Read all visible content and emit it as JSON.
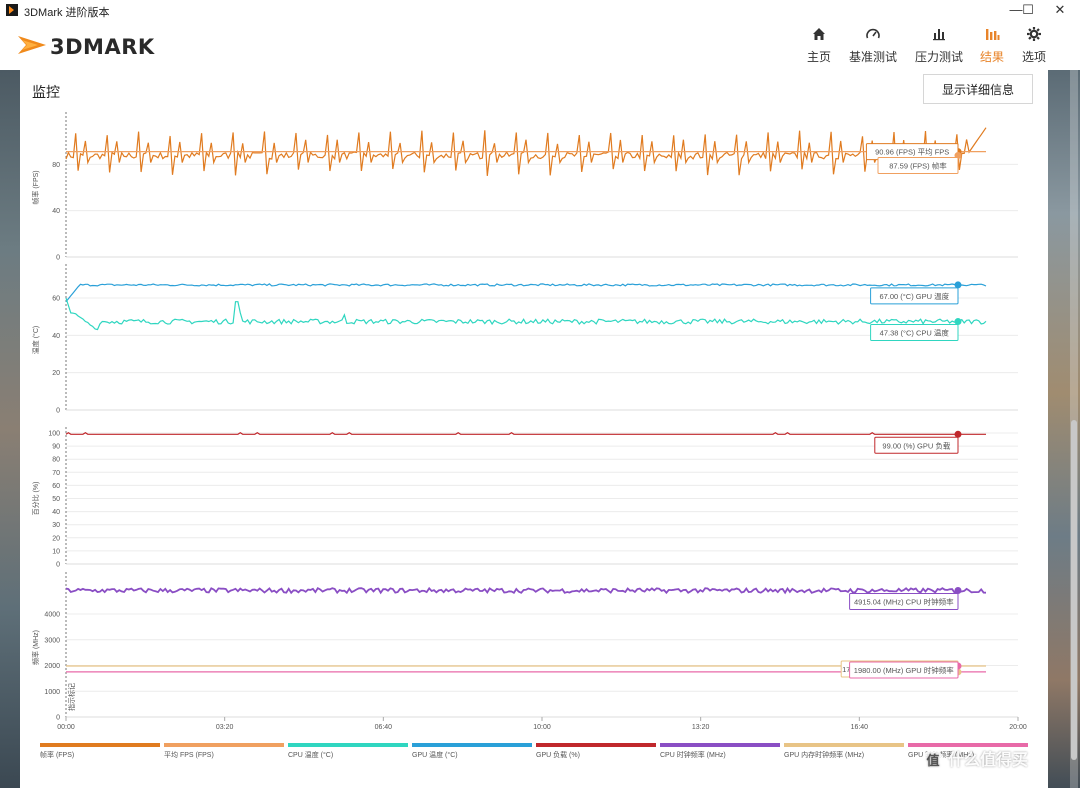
{
  "window": {
    "title": "3DMark 进阶版本",
    "minimize": "—",
    "maximize": "☐",
    "close": "✕"
  },
  "header": {
    "logo_text": "3DMARK",
    "nav": [
      {
        "label": "主页",
        "icon": "home-icon",
        "glyph": "⌂"
      },
      {
        "label": "基准测试",
        "icon": "gauge-icon",
        "glyph": "◔"
      },
      {
        "label": "压力测试",
        "icon": "bar-chart-icon",
        "glyph": "▮"
      },
      {
        "label": "结果",
        "icon": "results-icon",
        "glyph": "▮",
        "active": true
      },
      {
        "label": "选项",
        "icon": "gear-icon",
        "glyph": "⚙"
      }
    ]
  },
  "monitor": {
    "title": "监控",
    "detail_button": "显示详细信息"
  },
  "colors": {
    "fps": "#e07b20",
    "avg_fps": "#f0a060",
    "cpu_temp": "#2fd6c0",
    "gpu_temp": "#2aa0d8",
    "gpu_load": "#c0282c",
    "cpu_clock": "#8a4ec4",
    "gpu_mem_clock": "#e8c486",
    "gpu_clock": "#e86aa8"
  },
  "chart_data": {
    "type": "line",
    "x_ticks": [
      "00:00",
      "03:20",
      "06:40",
      "10:00",
      "13:20",
      "16:40",
      "20:00"
    ],
    "x_range_seconds": [
      0,
      1200
    ],
    "panels": [
      {
        "ylabel": "帧率 (FPS)",
        "ylim": [
          0,
          120
        ],
        "y_ticks": [
          0,
          40,
          80
        ],
        "series": [
          {
            "name": "帧率 (FPS)",
            "color": "#e07b20",
            "pattern": "spiky",
            "base": 87.59,
            "min": 70,
            "max": 110
          },
          {
            "name": "平均 FPS (FPS)",
            "color": "#f0a060",
            "pattern": "flat",
            "value": 90.96
          }
        ],
        "callouts": [
          {
            "text": "90.96 (FPS) 平均 FPS",
            "value": 90.96
          },
          {
            "text": "87.59 (FPS) 帧率",
            "value": 87.59
          }
        ]
      },
      {
        "ylabel": "温度 (°C)",
        "ylim": [
          0,
          75
        ],
        "y_ticks": [
          0,
          20,
          40,
          60
        ],
        "series": [
          {
            "name": "GPU 温度 (°C)",
            "color": "#2aa0d8",
            "pattern": "gpu_temp",
            "value": 67.0
          },
          {
            "name": "CPU 温度 (°C)",
            "color": "#2fd6c0",
            "pattern": "cpu_temp",
            "value": 47.38
          }
        ],
        "callouts": [
          {
            "text": "67.00 (°C) GPU 温度",
            "value": 67.0
          },
          {
            "text": "47.38 (°C) CPU 温度",
            "value": 47.38
          }
        ]
      },
      {
        "ylabel": "百分比 (%)",
        "ylim": [
          0,
          100
        ],
        "y_ticks": [
          0,
          10,
          20,
          30,
          40,
          50,
          60,
          70,
          80,
          90,
          100
        ],
        "series": [
          {
            "name": "GPU 负载 (%)",
            "color": "#c0282c",
            "pattern": "flat_noise",
            "value": 99.0
          }
        ],
        "callouts": [
          {
            "text": "99.00 (%) GPU 负载",
            "value": 99.0
          }
        ]
      },
      {
        "ylabel": "频率 (MHz)",
        "ylim": [
          0,
          5400
        ],
        "y_ticks": [
          0,
          1000,
          2000,
          3000,
          4000
        ],
        "series": [
          {
            "name": "CPU 时钟频率 (MHz)",
            "color": "#8a4ec4",
            "pattern": "noisy",
            "value": 4915.04
          },
          {
            "name": "GPU 时钟频率 (MHz)",
            "color": "#e8c486",
            "pattern": "flat",
            "value": 1980.0
          },
          {
            "name": "GPU 内存时钟频率 (MHz)",
            "color": "#e86aa8",
            "pattern": "flat",
            "value": 1750.25
          }
        ],
        "callouts": [
          {
            "text": "4915.04 (MHz) CPU 时钟频率",
            "value": 4915.04
          },
          {
            "text": "1750.25 (MHz) GPU 内存时钟频率",
            "value": 1750.25
          },
          {
            "text": "1980.00 (MHz) GPU 时钟频率",
            "value": 1980.0
          }
        ],
        "side_label": "指示标记"
      }
    ],
    "legend": [
      {
        "label": "帧率 (FPS)",
        "color": "#e07b20"
      },
      {
        "label": "平均 FPS (FPS)",
        "color": "#f0a060"
      },
      {
        "label": "CPU 温度 (°C)",
        "color": "#2fd6c0"
      },
      {
        "label": "GPU 温度 (°C)",
        "color": "#2aa0d8"
      },
      {
        "label": "GPU 负载 (%)",
        "color": "#c0282c"
      },
      {
        "label": "CPU 时钟频率 (MHz)",
        "color": "#8a4ec4"
      },
      {
        "label": "GPU 内存时钟频率 (MHz)",
        "color": "#e8c486"
      },
      {
        "label": "GPU 时钟频率 (MHz)",
        "color": "#e86aa8"
      }
    ]
  },
  "watermark": {
    "badge": "值",
    "text": "什么值得买"
  }
}
